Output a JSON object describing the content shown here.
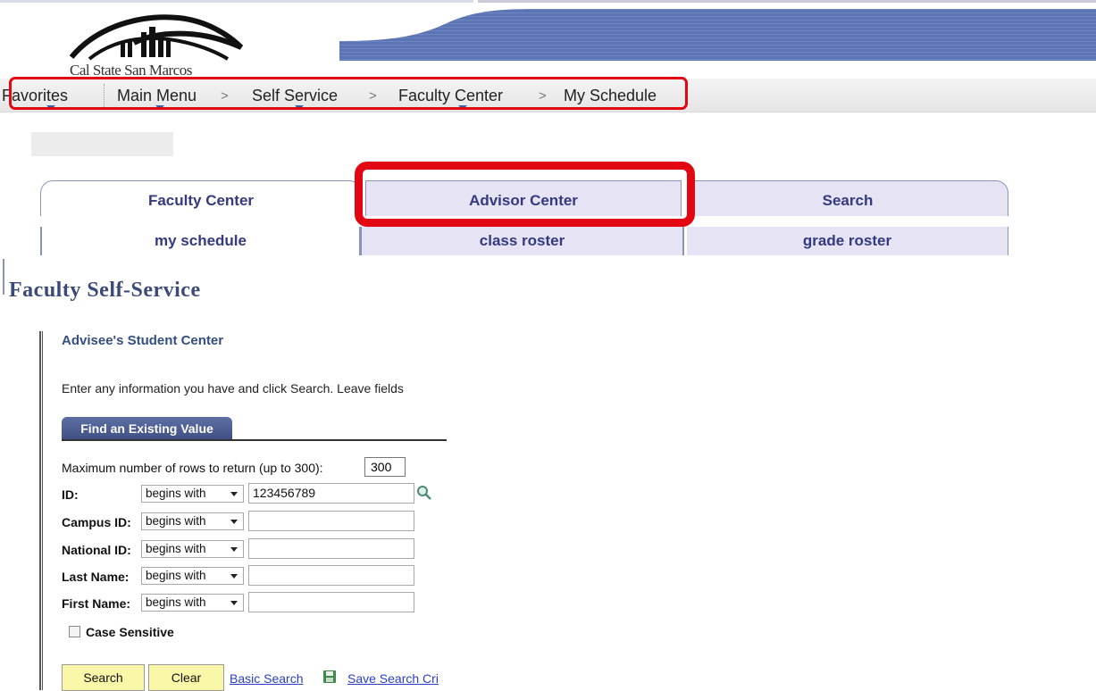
{
  "header": {
    "logo_text": "Cal State San Marcos"
  },
  "nav": {
    "favorites": "Favorites",
    "main_menu": "Main Menu",
    "self_service": "Self Service",
    "faculty_center": "Faculty Center",
    "my_schedule": "My Schedule",
    "separator": ">"
  },
  "tabs": {
    "top": [
      "Faculty Center",
      "Advisor Center",
      "Search"
    ],
    "sub": [
      "my schedule",
      "class roster",
      "grade roster"
    ]
  },
  "page_title": "Faculty Self-Service",
  "search_page": {
    "title": "Advisee's Student Center",
    "instructions": "Enter any information you have and click Search. Leave fields",
    "tab_label": "Find an Existing Value",
    "max_rows_label": "Maximum number of rows to return (up to 300):",
    "max_rows_value": "300",
    "fields": [
      {
        "label": "ID:",
        "operator": "begins with",
        "value": "123456789"
      },
      {
        "label": "Campus ID:",
        "operator": "begins with",
        "value": ""
      },
      {
        "label": "National ID:",
        "operator": "begins with",
        "value": ""
      },
      {
        "label": "Last Name:",
        "operator": "begins with",
        "value": ""
      },
      {
        "label": "First Name:",
        "operator": "begins with",
        "value": ""
      }
    ],
    "case_sensitive_label": "Case Sensitive",
    "search_button": "Search",
    "clear_button": "Clear",
    "basic_search_link": "Basic Search",
    "save_search_link": "Save Search Cri"
  },
  "colors": {
    "highlight": "#e30613",
    "tab_text": "#343a80",
    "tab_bg": "#e6e3f5",
    "button_bg": "#faf7a8",
    "link": "#2a40c8"
  },
  "icons": {
    "lookup": "magnifier-icon",
    "save": "save-disk-icon"
  }
}
